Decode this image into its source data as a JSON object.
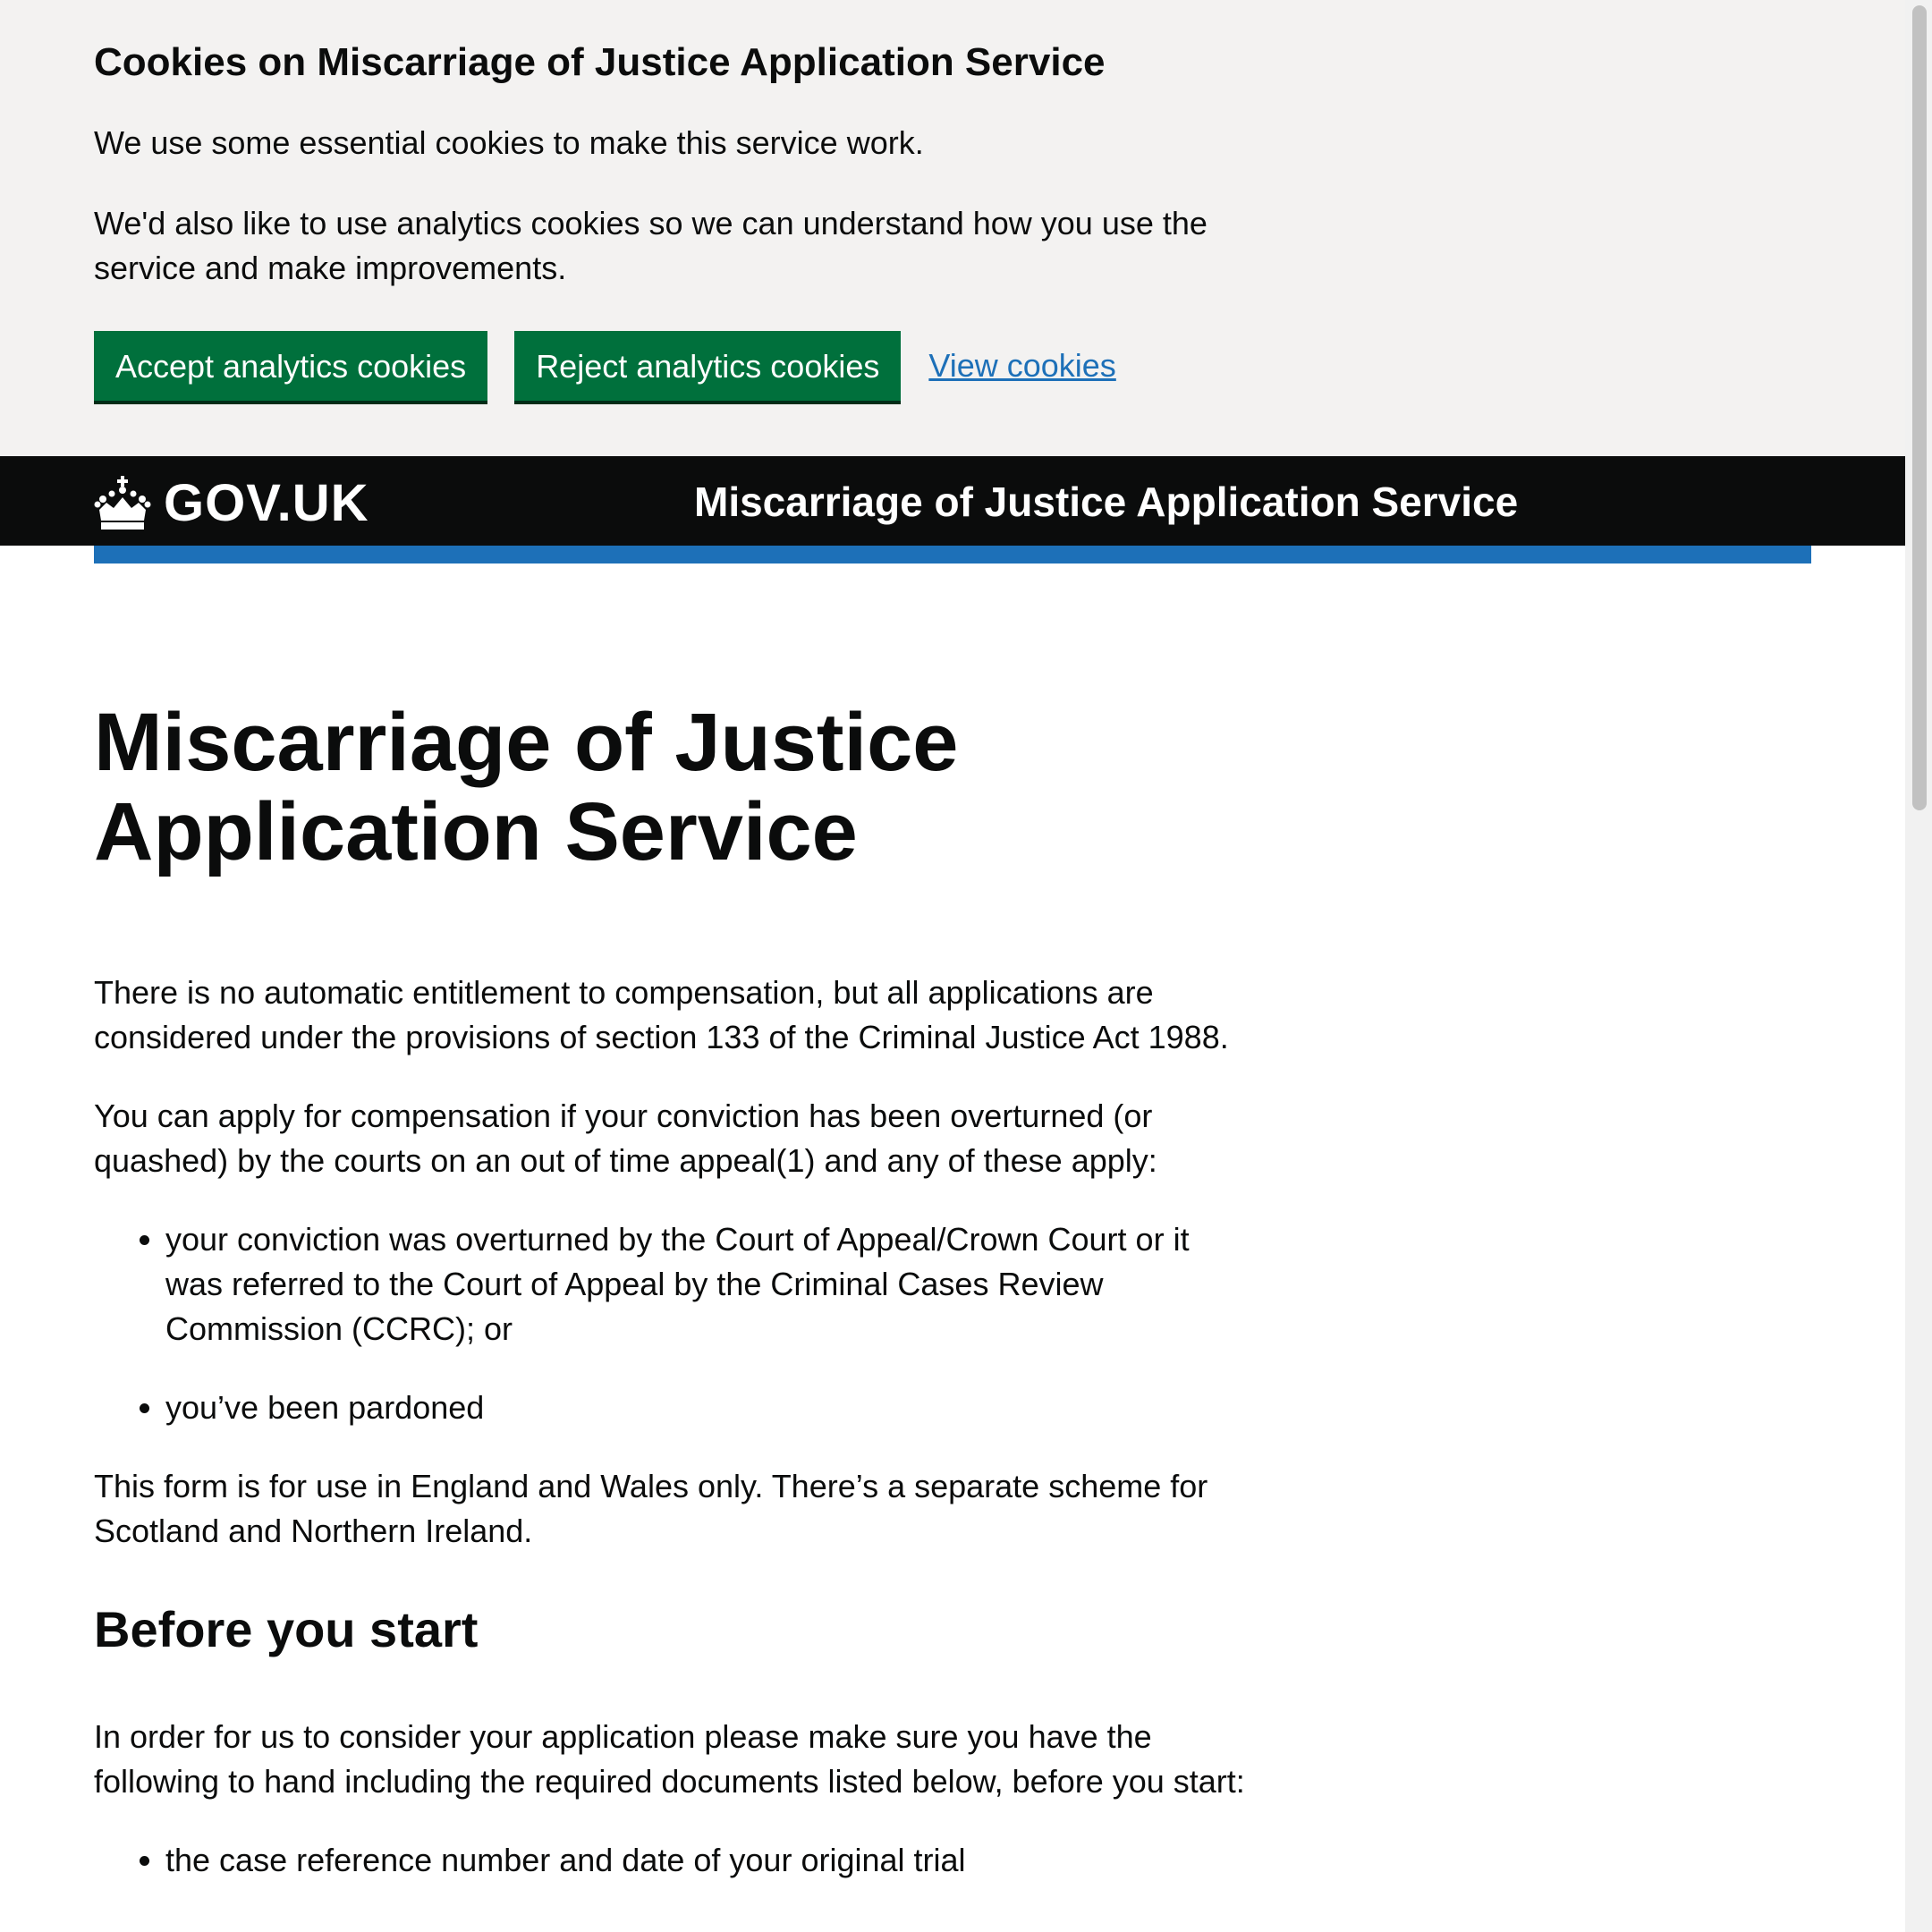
{
  "cookie_banner": {
    "title": "Cookies on Miscarriage of Justice Application Service",
    "text1": "We use some essential cookies to make this service work.",
    "text2": "We'd also like to use analytics cookies so we can understand how you use the service and make improvements.",
    "accept_label": "Accept analytics cookies",
    "reject_label": "Reject analytics cookies",
    "view_label": "View cookies"
  },
  "header": {
    "logo_text": "GOV.UK",
    "logo_icon": "crown-icon",
    "service_name": "Miscarriage of Justice Application Service"
  },
  "main": {
    "title": "Miscarriage of Justice Application Service",
    "para1": "There is no automatic entitlement to compensation, but all applications are considered under the provisions of section 133 of the Criminal Justice Act 1988.",
    "para2": "You can apply for compensation if your conviction has been overturned (or quashed) by the courts on an out of time appeal(1) and any of these apply:",
    "list": [
      "your conviction was overturned by the Court of Appeal/Crown Court or it was referred to the Court of Appeal by the Criminal Cases Review Commission (CCRC); or",
      "you’ve been pardoned"
    ],
    "para3": "This form is for use in England and Wales only. There’s a separate scheme for Scotland and Northern Ireland.",
    "section_heading": "Before you start",
    "para4": "In order for us to consider your application please make sure you have the following to hand including the required documents listed below, before you start:",
    "list2": [
      "the case reference number and date of your original trial"
    ]
  },
  "colors": {
    "button_green": "#00703c",
    "link_blue": "#1d70b8",
    "header_black": "#0b0c0c",
    "banner_grey": "#f3f2f1"
  }
}
